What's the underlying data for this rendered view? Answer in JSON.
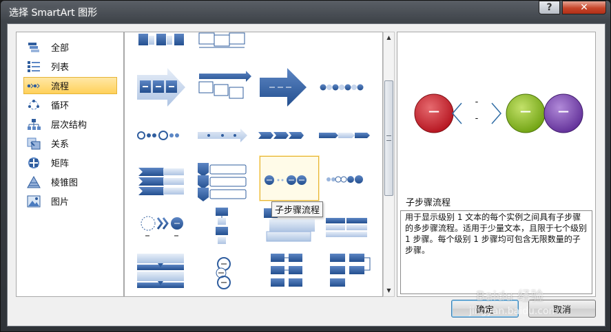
{
  "window": {
    "title": "选择 SmartArt 图形",
    "help_label": "?",
    "close_label": "✕"
  },
  "categories": [
    {
      "label": "全部",
      "icon": "all-icon"
    },
    {
      "label": "列表",
      "icon": "list-icon"
    },
    {
      "label": "流程",
      "icon": "process-icon",
      "selected": true
    },
    {
      "label": "循环",
      "icon": "cycle-icon"
    },
    {
      "label": "层次结构",
      "icon": "hierarchy-icon"
    },
    {
      "label": "关系",
      "icon": "relationship-icon"
    },
    {
      "label": "矩阵",
      "icon": "matrix-icon"
    },
    {
      "label": "棱锥图",
      "icon": "pyramid-icon"
    },
    {
      "label": "图片",
      "icon": "picture-icon"
    }
  ],
  "gallery": {
    "selected_tooltip": "子步骤流程"
  },
  "preview": {
    "layout_name": "子步骤流程",
    "description": "用于显示级别 1 文本的每个实例之间具有子步骤的多步骤流程。适用于少量文本，且限于七个级别 1 步骤。每个级别 1 步骤均可包含无限数量的子步骤。",
    "dash_glyph": "—",
    "sub_dash": "-"
  },
  "buttons": {
    "ok": "确定",
    "cancel": "取消"
  },
  "watermark": {
    "logo": "Baidu 经验",
    "url": "jingyan.baidu.com"
  },
  "colors": {
    "accent": "#2f5d9e",
    "selection": "#ffd15a",
    "red_node": "#c8232c",
    "green_node": "#8cbf26",
    "purple_node": "#7a48b0"
  }
}
